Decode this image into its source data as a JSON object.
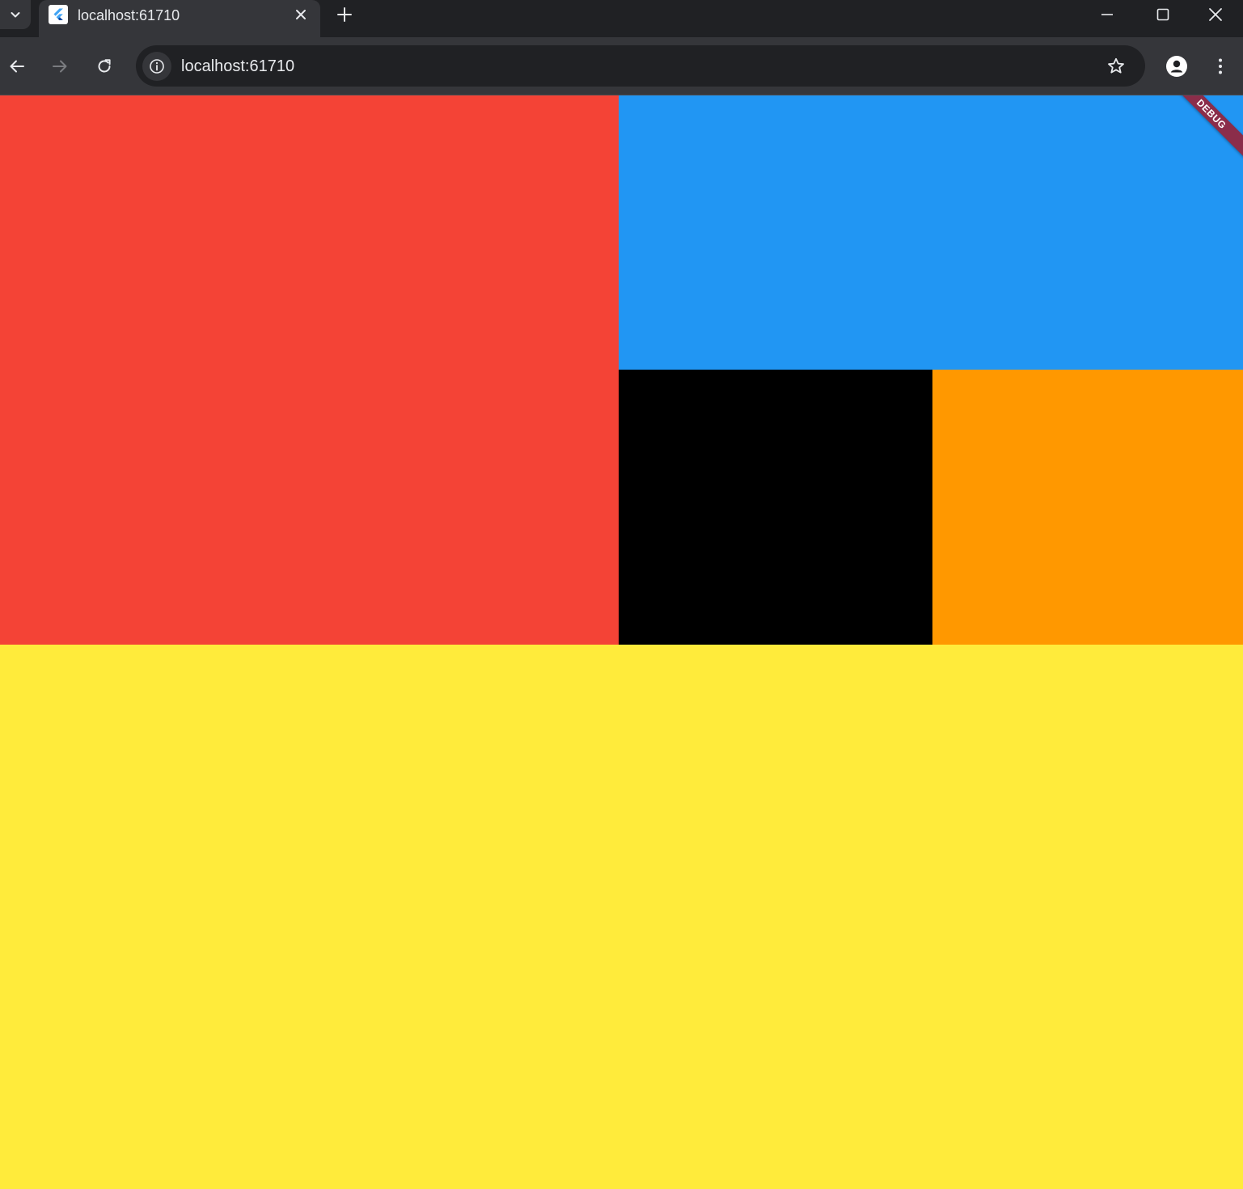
{
  "browser": {
    "tab": {
      "title": "localhost:61710",
      "favicon": "flutter-icon"
    },
    "address_bar": {
      "url": "localhost:61710"
    },
    "window_controls": [
      "minimize-icon",
      "maximize-icon",
      "close-icon"
    ],
    "colors": {
      "tabbar": "#202124",
      "toolbar": "#35363a",
      "omnibox": "#202124",
      "text": "#e8eaed",
      "icon": "#e8eaed",
      "icon_disabled": "#7a7c80"
    }
  },
  "app": {
    "debug_banner": {
      "label": "DEBUG",
      "color": "#8b2d4a"
    },
    "blocks": {
      "red": "#f44336",
      "blue": "#2196f3",
      "black": "#000000",
      "orange": "#ff9800",
      "yellow": "#ffeb3b"
    }
  }
}
